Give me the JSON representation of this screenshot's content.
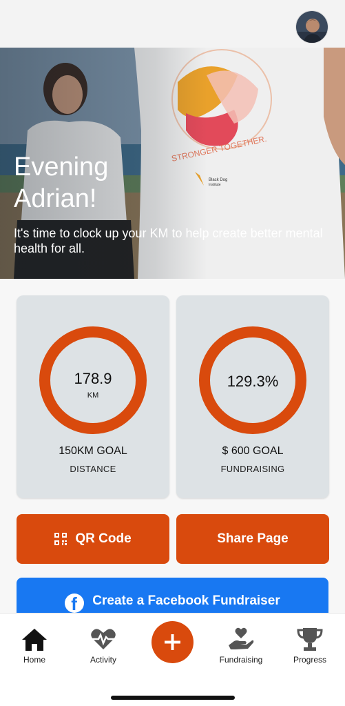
{
  "header": {
    "avatar_alt": "User avatar"
  },
  "hero": {
    "greeting": "Evening\nAdrian!",
    "greeting_line1": "Evening",
    "greeting_line2": "Adrian!",
    "subtitle": "It's time to clock up your KM to help create better mental health for all.",
    "shirt_text": "STRONGER TOGETHER.",
    "brand_text": "Black Dog Institute"
  },
  "stats": {
    "distance": {
      "value": "178.9",
      "unit": "KM",
      "goal": "150KM GOAL",
      "category": "DISTANCE"
    },
    "fundraising": {
      "value": "129.3%",
      "goal": "$ 600 GOAL",
      "category": "FUNDRAISING"
    }
  },
  "actions": {
    "qr_label": "QR Code",
    "share_label": "Share Page",
    "facebook_label": "Create a Facebook Fundraiser"
  },
  "tabs": {
    "home": "Home",
    "activity": "Activity",
    "fundraising": "Fundraising",
    "progress": "Progress"
  },
  "colors": {
    "accent": "#d94a0d",
    "facebook": "#1878f2",
    "card_bg": "#dde2e5"
  }
}
